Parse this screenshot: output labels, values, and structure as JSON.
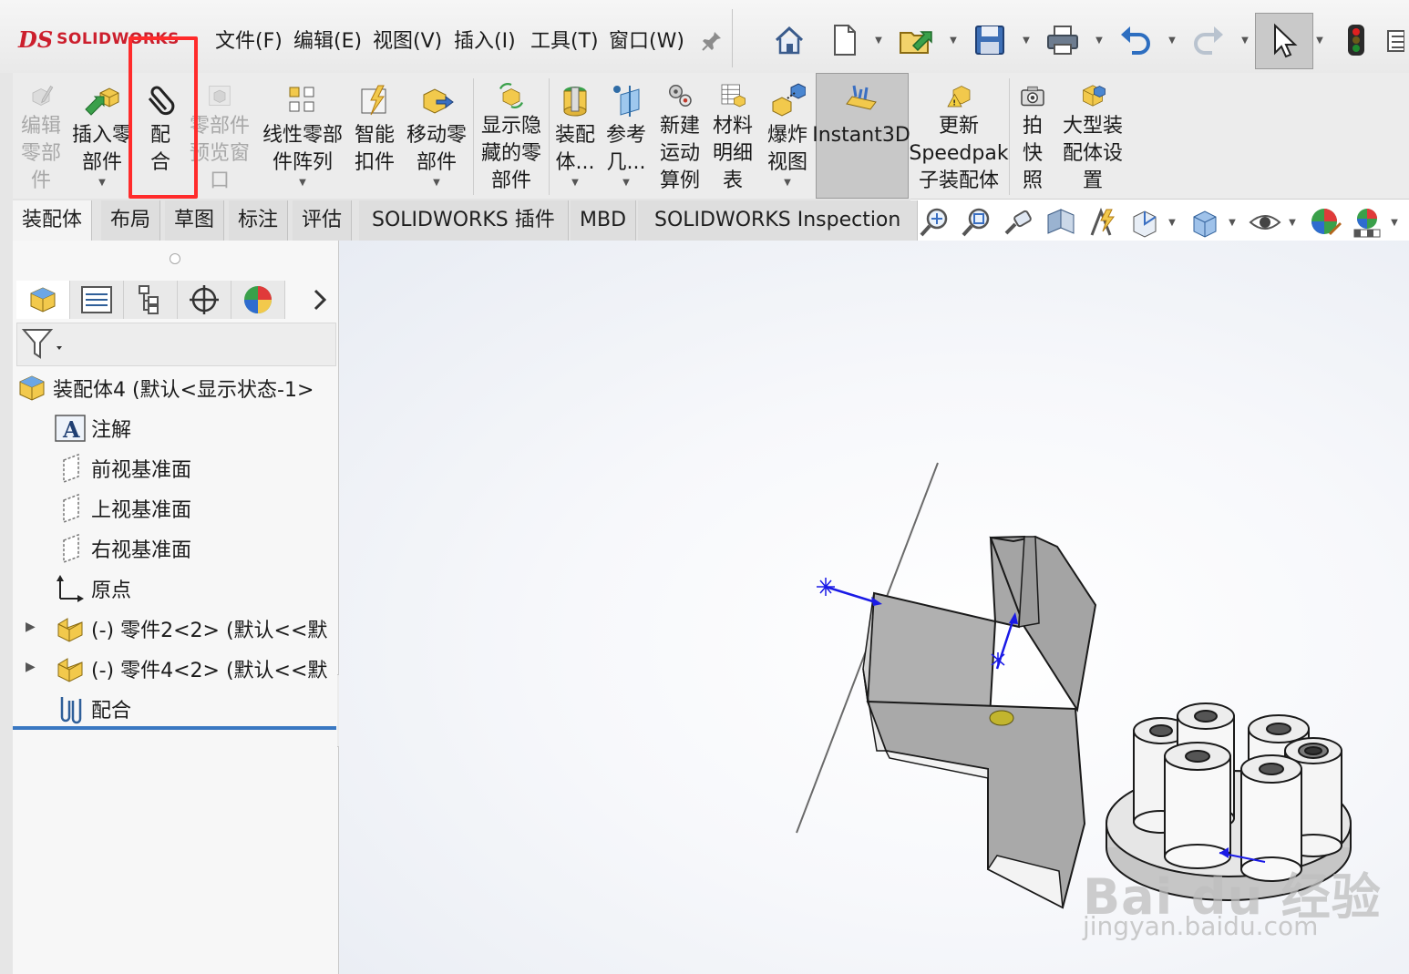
{
  "app": {
    "brand_mark": "DS",
    "brand_name": "SOLIDWORKS"
  },
  "menu": {
    "items": [
      "文件(F)",
      "编辑(E)",
      "视图(V)",
      "插入(I)",
      "工具(T)",
      "窗口(W)"
    ],
    "pin_icon": "pin-icon"
  },
  "toolbar": {
    "icons": [
      "home-icon",
      "new-document-icon",
      "open-icon",
      "save-icon",
      "print-icon",
      "undo-icon",
      "redo-icon",
      "select-cursor-icon",
      "rebuild-traffic-light-icon",
      "options-icon"
    ]
  },
  "command_manager": {
    "buttons": [
      {
        "label": "编辑\n零部\n件",
        "enabled": false,
        "has_dropdown": false
      },
      {
        "label": "插入零\n部件",
        "enabled": true,
        "has_dropdown": true
      },
      {
        "label": "配\n合",
        "enabled": true,
        "has_dropdown": false
      },
      {
        "label": "零部件\n预览窗\n口",
        "enabled": false,
        "has_dropdown": false
      },
      {
        "label": "线性零部\n件阵列",
        "enabled": true,
        "has_dropdown": true
      },
      {
        "label": "智能\n扣件",
        "enabled": true,
        "has_dropdown": false
      },
      {
        "label": "移动零\n部件",
        "enabled": true,
        "has_dropdown": true
      },
      {
        "label": "显示隐\n藏的零\n部件",
        "enabled": true,
        "has_dropdown": false
      },
      {
        "label": "装配\n体...",
        "enabled": true,
        "has_dropdown": true
      },
      {
        "label": "参考\n几...",
        "enabled": true,
        "has_dropdown": true
      },
      {
        "label": "新建\n运动\n算例",
        "enabled": true,
        "has_dropdown": false
      },
      {
        "label": "材料\n明细\n表",
        "enabled": true,
        "has_dropdown": false
      },
      {
        "label": "爆炸\n视图",
        "enabled": true,
        "has_dropdown": true
      },
      {
        "label": "Instant3D",
        "enabled": true,
        "has_dropdown": false,
        "active": true
      },
      {
        "label": "更新\nSpeedpak\n子装配体",
        "enabled": true,
        "has_dropdown": false
      },
      {
        "label": "拍\n快\n照",
        "enabled": true,
        "has_dropdown": false
      },
      {
        "label": "大型装\n配体设\n置",
        "enabled": true,
        "has_dropdown": false
      }
    ]
  },
  "tabs": [
    "装配体",
    "布局",
    "草图",
    "标注",
    "评估",
    "SOLIDWORKS 插件",
    "MBD",
    "SOLIDWORKS Inspection"
  ],
  "active_tab": "装配体",
  "heads_up_toolbar": {
    "icons": [
      "zoom-to-fit-icon",
      "zoom-area-icon",
      "previous-view-icon",
      "section-view-icon",
      "dynamic-annotation-icon",
      "view-orientation-icon",
      "display-style-icon",
      "hide-show-icon",
      "edit-appearance-icon",
      "apply-scene-icon"
    ]
  },
  "panel": {
    "tab_icons": [
      "feature-manager-icon",
      "property-manager-icon",
      "configuration-manager-icon",
      "dimxpert-icon",
      "display-manager-icon"
    ],
    "more_icon": "chevron-right-icon",
    "filter_icon": "filter-icon"
  },
  "tree": {
    "root": "装配体4 (默认<显示状态-1>",
    "items": [
      {
        "label": "注解",
        "icon": "annotation-icon",
        "expandable": false
      },
      {
        "label": "前视基准面",
        "icon": "plane-icon",
        "expandable": false
      },
      {
        "label": "上视基准面",
        "icon": "plane-icon",
        "expandable": false
      },
      {
        "label": "右视基准面",
        "icon": "plane-icon",
        "expandable": false
      },
      {
        "label": "原点",
        "icon": "origin-icon",
        "expandable": false
      },
      {
        "label": "(-) 零件2<2> (默认<<默",
        "icon": "part-icon",
        "expandable": true
      },
      {
        "label": "(-) 零件4<2> (默认<<默",
        "icon": "part-icon",
        "expandable": true
      },
      {
        "label": "配合",
        "icon": "mates-icon",
        "expandable": false
      }
    ]
  },
  "watermark": {
    "line1": "Bai du 经验",
    "line2": "jingyan.baidu.com"
  },
  "colors": {
    "highlight": "#ff2b2b",
    "brand": "#cc1f2d",
    "tree_end_bar": "#3a78c2",
    "part_grey": "#a9a9a9",
    "triad_blue": "#1a1ae6"
  }
}
